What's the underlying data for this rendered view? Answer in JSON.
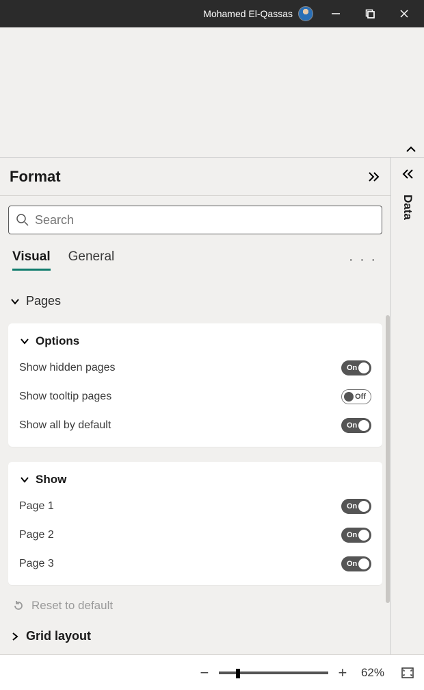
{
  "titlebar": {
    "username": "Mohamed El-Qassas"
  },
  "panes": {
    "format_title": "Format",
    "data_title": "Data"
  },
  "search": {
    "placeholder": "Search"
  },
  "tabs": {
    "visual": "Visual",
    "general": "General"
  },
  "sections": {
    "pages": {
      "label": "Pages",
      "options": {
        "label": "Options",
        "items": [
          {
            "label": "Show hidden pages",
            "state": "on",
            "state_label": "On"
          },
          {
            "label": "Show tooltip pages",
            "state": "off",
            "state_label": "Off"
          },
          {
            "label": "Show all by default",
            "state": "on",
            "state_label": "On"
          }
        ]
      },
      "show": {
        "label": "Show",
        "items": [
          {
            "label": "Page 1",
            "state": "on",
            "state_label": "On"
          },
          {
            "label": "Page 2",
            "state": "on",
            "state_label": "On"
          },
          {
            "label": "Page 3",
            "state": "on",
            "state_label": "On"
          }
        ]
      }
    },
    "reset_label": "Reset to default",
    "grid_layout_label": "Grid layout"
  },
  "statusbar": {
    "zoom_value": "62%"
  }
}
